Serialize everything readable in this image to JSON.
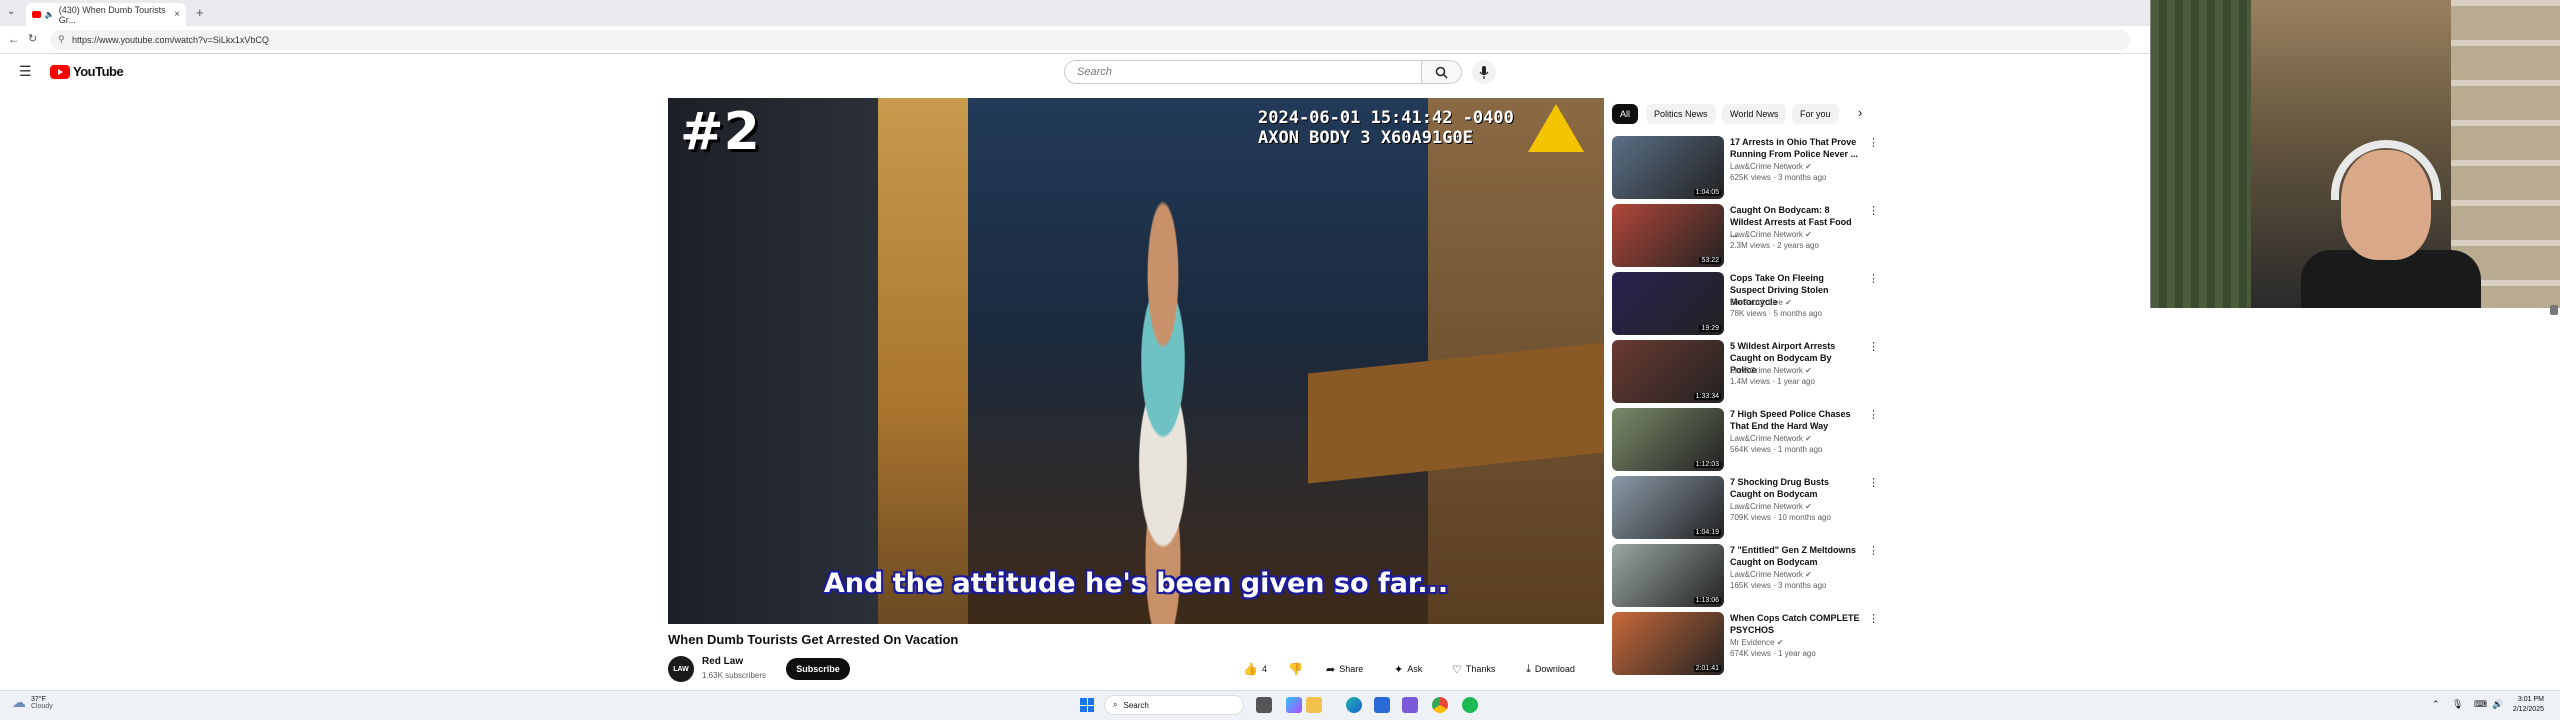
{
  "browser": {
    "tab_title": "(430) When Dumb Tourists Gr...",
    "tab_close": "×",
    "new_tab": "+",
    "url": "https://www.youtube.com/watch?v=SiLkx1xVbCQ"
  },
  "youtube": {
    "logo_text": "YouTube",
    "search_placeholder": "Search"
  },
  "video": {
    "overlay_number": "#2",
    "timestamp_line1": "2024-06-01 15:41:42 -0400",
    "timestamp_line2": "AXON BODY 3 X60A91G0E",
    "subtitle": "And the attitude he's been given so far...",
    "title": "When Dumb Tourists Get Arrested On Vacation",
    "channel_name": "Red Law",
    "channel_avatar_text": "LAW",
    "subscribers": "1.63K subscribers",
    "subscribe_label": "Subscribe",
    "like_count": "4",
    "share_label": "Share",
    "ask_label": "Ask",
    "thanks_label": "Thanks",
    "download_label": "Download"
  },
  "chips": [
    "All",
    "Politics News",
    "World News",
    "For you"
  ],
  "recommendations": [
    {
      "title": "17 Arrests in Ohio That Prove Running From Police Never ...",
      "channel": "Law&Crime Network",
      "meta": "625K views · 3 months ago",
      "duration": "1:04:05",
      "color": "#5b6f86"
    },
    {
      "title": "Caught On Bodycam: 8 Wildest Arrests at Fast Food ...",
      "channel": "Law&Crime Network",
      "meta": "2.3M views · 2 years ago",
      "duration": "53:22",
      "color": "#b0473a"
    },
    {
      "title": "Cops Take On Fleeing Suspect Driving Stolen Motorcycle",
      "channel": "On Patrol: Live",
      "meta": "78K views · 5 months ago",
      "duration": "19:29",
      "color": "#2a2250"
    },
    {
      "title": "5 Wildest Airport Arrests Caught on Bodycam By Police",
      "channel": "Law&Crime Network",
      "meta": "1.4M views · 1 year ago",
      "duration": "1:33:34",
      "color": "#6a3a32"
    },
    {
      "title": "7 High Speed Police Chases That End the Hard Way",
      "channel": "Law&Crime Network",
      "meta": "564K views · 1 month ago",
      "duration": "1:12:03",
      "color": "#7a8a6a"
    },
    {
      "title": "7 Shocking Drug Busts Caught on Bodycam",
      "channel": "Law&Crime Network",
      "meta": "709K views · 10 months ago",
      "duration": "1:04:19",
      "color": "#8a9aa8"
    },
    {
      "title": "7 \"Entitled\" Gen Z Meltdowns Caught on Bodycam",
      "channel": "Law&Crime Network",
      "meta": "165K views · 3 months ago",
      "duration": "1:13:06",
      "color": "#9aa8a0"
    },
    {
      "title": "When Cops Catch COMPLETE PSYCHOS",
      "channel": "Mr Evidence",
      "meta": "674K views · 1 year ago",
      "duration": "2:01:41",
      "color": "#c86a3a"
    }
  ],
  "taskbar": {
    "weather_temp": "37°F",
    "weather_desc": "Cloudy",
    "search_label": "Search",
    "time": "3:01 PM",
    "date": "2/12/2025"
  }
}
